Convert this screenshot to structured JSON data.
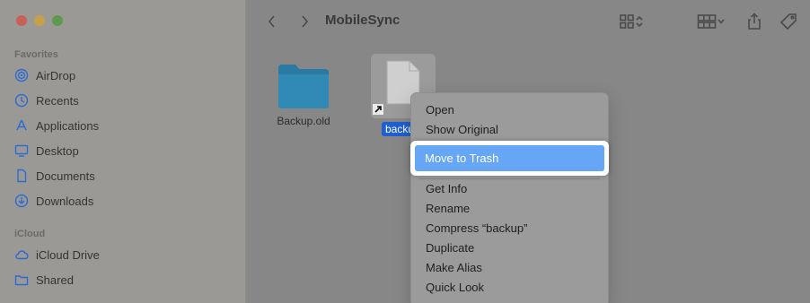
{
  "window": {
    "title": "MobileSync",
    "traffic_colors": {
      "close": "#c96057",
      "minimize": "#c7a14a",
      "zoom": "#5b9a4f"
    }
  },
  "sidebar": {
    "favorites_title": "Favorites",
    "favorites": [
      {
        "label": "AirDrop",
        "icon": "airdrop-icon"
      },
      {
        "label": "Recents",
        "icon": "clock-icon"
      },
      {
        "label": "Applications",
        "icon": "applications-icon"
      },
      {
        "label": "Desktop",
        "icon": "desktop-icon"
      },
      {
        "label": "Documents",
        "icon": "document-icon"
      },
      {
        "label": "Downloads",
        "icon": "download-icon"
      }
    ],
    "icloud_title": "iCloud",
    "icloud": [
      {
        "label": "iCloud Drive",
        "icon": "cloud-icon"
      },
      {
        "label": "Shared",
        "icon": "shared-folder-icon"
      }
    ],
    "accent_color": "#2e6bd0"
  },
  "files": [
    {
      "name": "Backup.old",
      "icon": "folder-icon",
      "folder_color": "#2d7fa8"
    },
    {
      "name": "backup",
      "visible_label": "backu",
      "icon": "alias-file-icon",
      "selected": true
    }
  ],
  "context_menu": {
    "group1": [
      "Open",
      "Show Original"
    ],
    "highlighted": "Move to Trash",
    "group2": [
      "Get Info",
      "Rename",
      "Compress “backup”",
      "Duplicate",
      "Make Alias",
      "Quick Look"
    ]
  }
}
